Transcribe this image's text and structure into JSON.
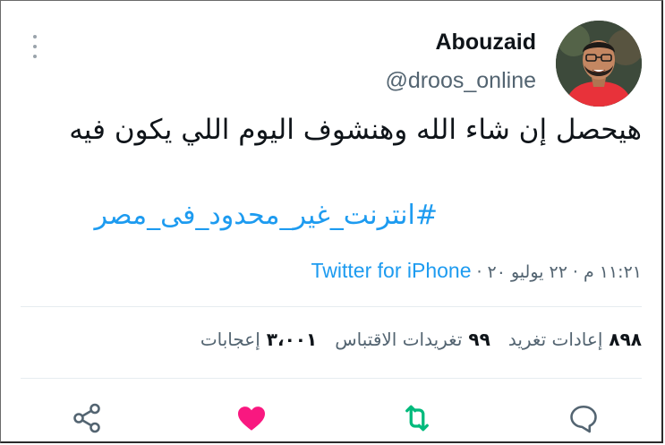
{
  "author": {
    "name": "Abouzaid",
    "handle": "@droos_online",
    "avatar_icon": "profile-photo"
  },
  "tweet": {
    "text": "هيحصل إن شاء الله وهنشوف اليوم اللي يكون فيه",
    "hashtag": "#انترنت_غير_محدود_فى_مصر"
  },
  "meta": {
    "time": "١١:٢١ م",
    "date": "٢٢ يوليو ٢٠",
    "separator": "·",
    "source": "Twitter for iPhone"
  },
  "stats": {
    "retweets_count": "٨٩٨",
    "retweets_label": "إعادات تغريد",
    "quotes_count": "٩٩",
    "quotes_label": "تغريدات الاقتباس",
    "likes_count": "٣،٠٠١",
    "likes_label": "إعجابات"
  },
  "colors": {
    "text": "#0f1419",
    "secondary": "#536471",
    "link": "#1d9bf0",
    "like": "#f91880",
    "retweet": "#00ba7c",
    "divider": "#e6ecf0"
  },
  "icons": {
    "more": "more-vertical-icon",
    "reply": "reply-icon",
    "retweet": "retweet-icon",
    "like": "heart-icon",
    "share": "share-icon"
  }
}
